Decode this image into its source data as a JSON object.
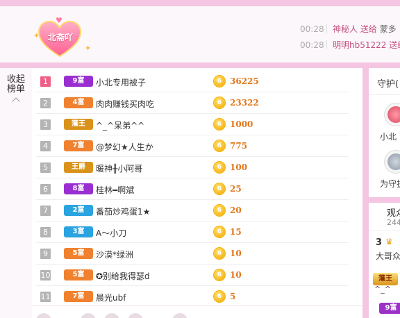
{
  "header": {
    "badge_label": "北斋吖",
    "ticker": [
      {
        "time": "00:28",
        "user": "神秘人",
        "action": "送给",
        "tail": "蒙多"
      },
      {
        "time": "00:28",
        "user": "明明hb51222",
        "action": "送给",
        "tail": ""
      }
    ]
  },
  "left": {
    "collapse_label": "收起榜单"
  },
  "ranking": {
    "rows": [
      {
        "rank": "1",
        "rank_color": "#ef5f86",
        "level": "9富",
        "level_color": "#9a2fd1",
        "name": "小北专用被子",
        "coin": "6",
        "score": "36225"
      },
      {
        "rank": "2",
        "rank_color": "#b4b4b4",
        "level": "4富",
        "level_color": "#f0822f",
        "name": "肉肉赚钱买肉吃",
        "coin": "6",
        "score": "23322"
      },
      {
        "rank": "3",
        "rank_color": "#b4b4b4",
        "level": "藩王",
        "level_color": "#d9931b",
        "name": "^_^呆弟^^",
        "coin": "6",
        "score": "1000"
      },
      {
        "rank": "4",
        "rank_color": "#b4b4b4",
        "level": "7富",
        "level_color": "#f0822f",
        "name": "@梦幻★人生か",
        "coin": "6",
        "score": "775"
      },
      {
        "rank": "5",
        "rank_color": "#b4b4b4",
        "level": "王爵",
        "level_color": "#d9931b",
        "name": "暖神╫小阿哥",
        "coin": "6",
        "score": "100"
      },
      {
        "rank": "6",
        "rank_color": "#b4b4b4",
        "level": "8富",
        "level_color": "#9a2fd1",
        "name": "桂林━啊斌",
        "coin": "6",
        "score": "25"
      },
      {
        "rank": "7",
        "rank_color": "#b4b4b4",
        "level": "2富",
        "level_color": "#2aa4e0",
        "name": "番茄炒鸡蛋1★",
        "coin": "6",
        "score": "20"
      },
      {
        "rank": "8",
        "rank_color": "#b4b4b4",
        "level": "3富",
        "level_color": "#2aa4e0",
        "name": "A～小刀",
        "coin": "6",
        "score": "15"
      },
      {
        "rank": "9",
        "rank_color": "#b4b4b4",
        "level": "5富",
        "level_color": "#f0822f",
        "name": "沙漠*绿洲",
        "coin": "6",
        "score": "10"
      },
      {
        "rank": "10",
        "rank_color": "#b4b4b4",
        "level": "5富",
        "level_color": "#f0822f",
        "name": "✪别给我得瑟d",
        "coin": "6",
        "score": "10"
      },
      {
        "rank": "11",
        "rank_color": "#b4b4b4",
        "level": "7富",
        "level_color": "#f0822f",
        "name": "晨光ubf",
        "coin": "6",
        "score": "5"
      }
    ]
  },
  "guard": {
    "title": "守护(",
    "members": [
      {
        "name": "小北",
        "icon": "avatar-icon"
      },
      {
        "name": "为守护",
        "icon": "avatar-icon"
      }
    ]
  },
  "audience": {
    "title": "观众",
    "count": "244",
    "rank_label": "3",
    "sub_label": "大哥众",
    "badge1": "藩王",
    "line2": "^_^",
    "badge2": "9富"
  }
}
